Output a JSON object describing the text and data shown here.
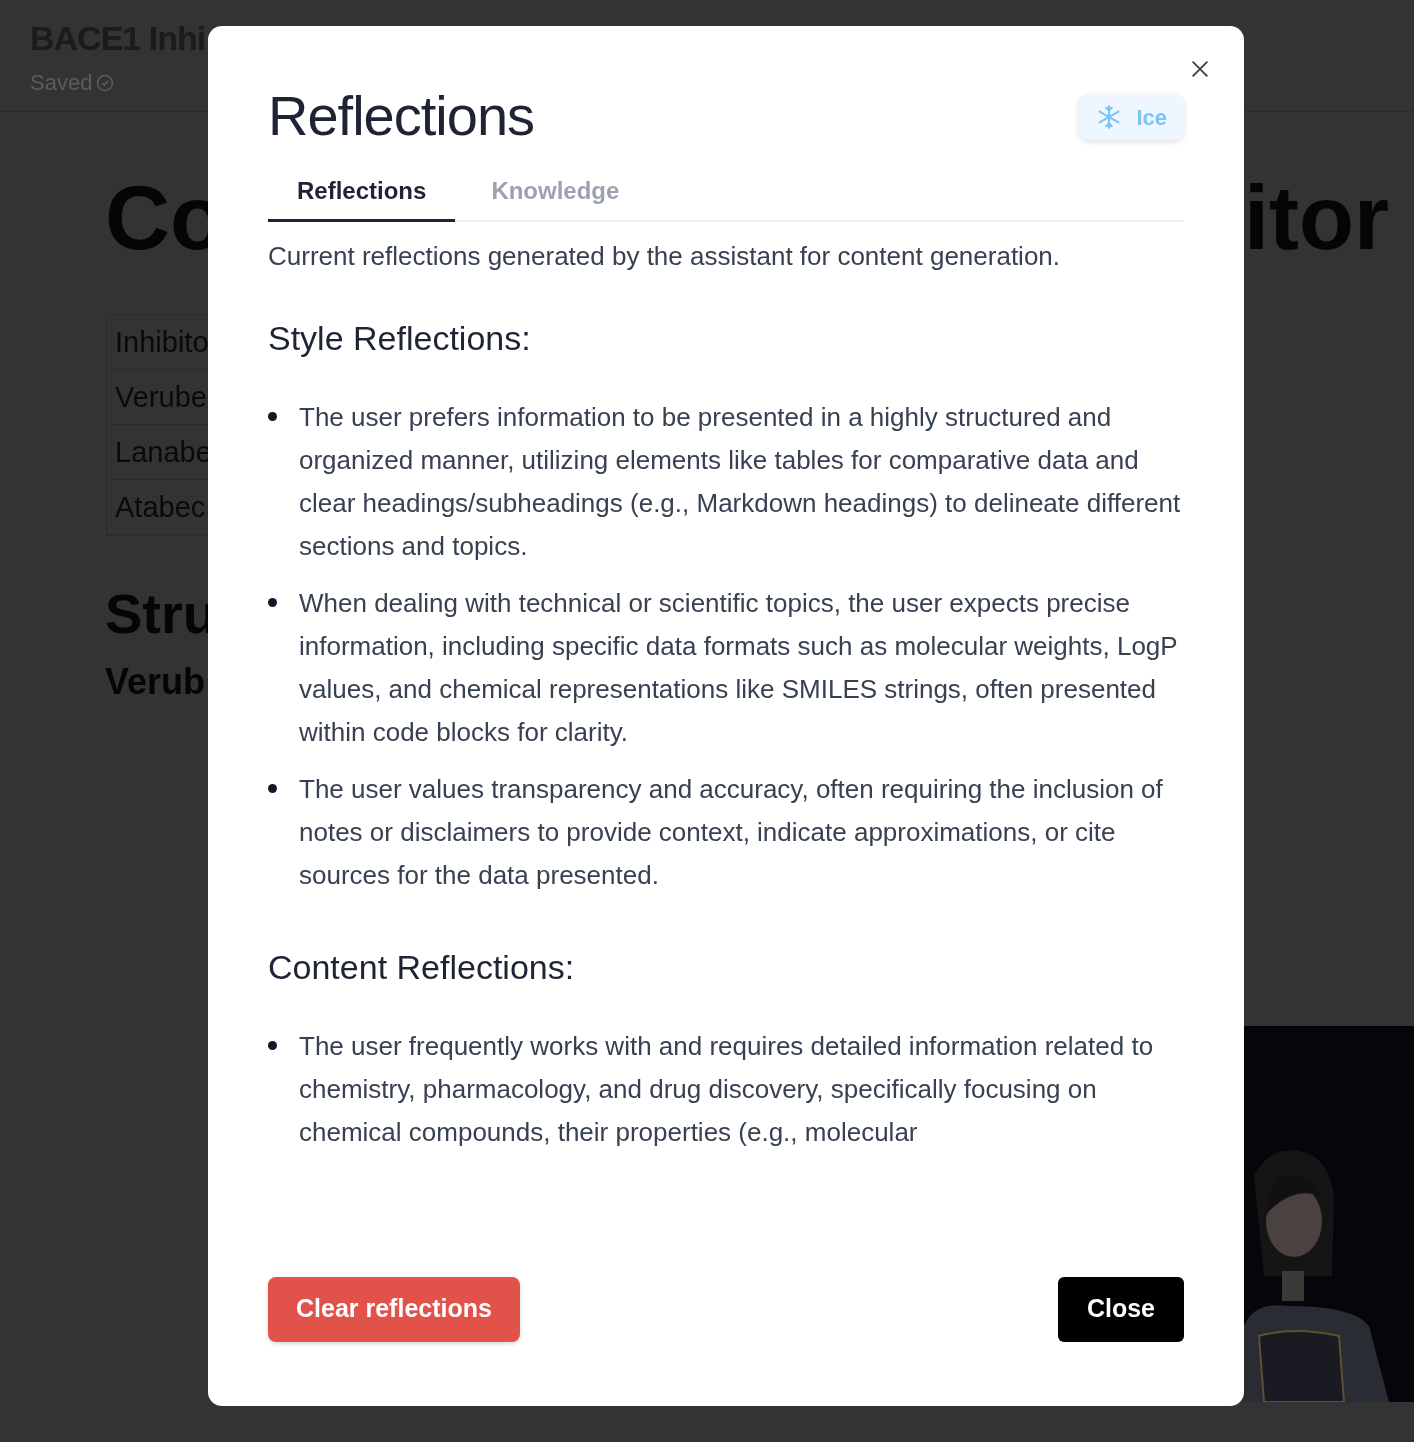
{
  "page": {
    "title": "BACE1 Inhi",
    "status": "Saved",
    "heading_left": "Co",
    "heading_right": "itor",
    "table_rows": [
      "Inhibito",
      "Verube",
      "Lanabe",
      "Atabec"
    ],
    "section_heading": "Stru",
    "subheading": "Verub"
  },
  "dialog": {
    "title": "Reflections",
    "badge": "Ice",
    "tabs": [
      {
        "label": "Reflections",
        "selected": true
      },
      {
        "label": "Knowledge",
        "selected": false
      }
    ],
    "description": "Current reflections generated by the assistant for content generation.",
    "sections": [
      {
        "heading": "Style Reflections:",
        "items": [
          "The user prefers information to be presented in a highly structured and organized manner, utilizing elements like tables for comparative data and clear headings/subheadings (e.g., Markdown headings) to delineate different sections and topics.",
          "When dealing with technical or scientific topics, the user expects precise information, including specific data formats such as molecular weights, LogP values, and chemical representations like SMILES strings, often presented within code blocks for clarity.",
          "The user values transparency and accuracy, often requiring the inclusion of notes or disclaimers to provide context, indicate approximations, or cite sources for the data presented."
        ]
      },
      {
        "heading": "Content Reflections:",
        "items": [
          "The user frequently works with and requires detailed information related to chemistry, pharmacology, and drug discovery, specifically focusing on chemical compounds, their properties (e.g., molecular"
        ]
      }
    ],
    "buttons": {
      "clear": "Clear reflections",
      "close": "Close"
    }
  }
}
